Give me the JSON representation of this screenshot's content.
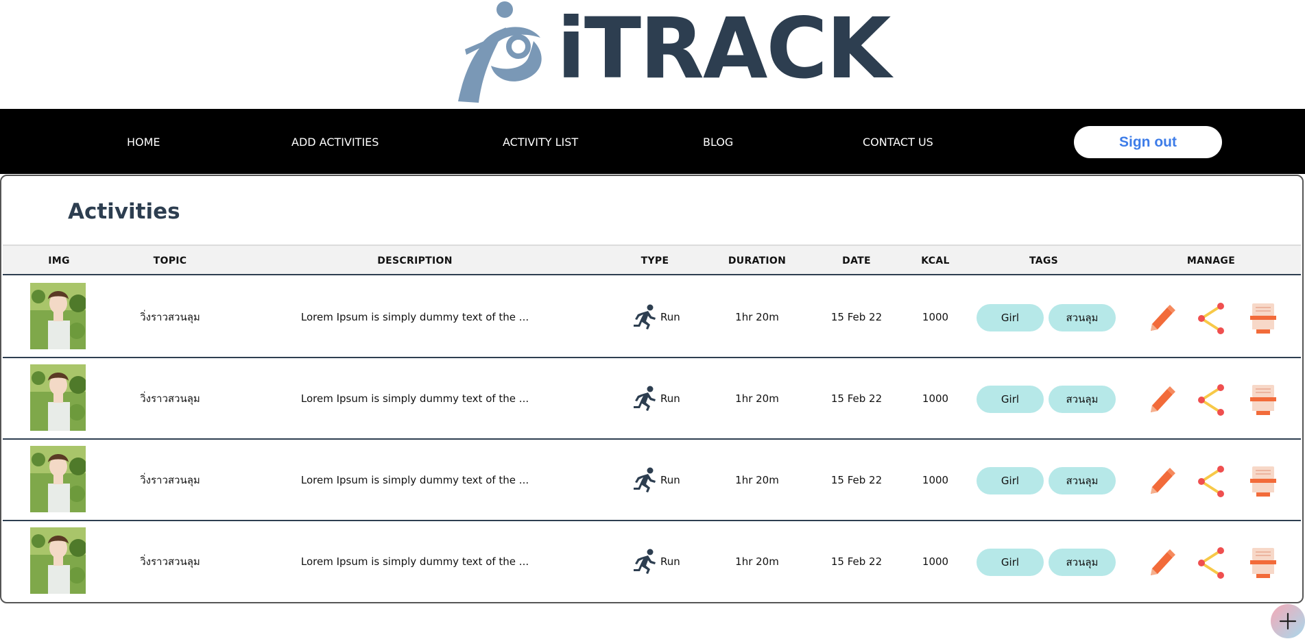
{
  "brand": {
    "name": "iTRACK"
  },
  "nav": {
    "items": [
      {
        "label": "HOME"
      },
      {
        "label": "ADD ACTIVITIES"
      },
      {
        "label": "ACTIVITY LIST"
      },
      {
        "label": "BLOG"
      },
      {
        "label": "CONTACT US"
      }
    ],
    "signout_label": "Sign out"
  },
  "page": {
    "title": "Activities"
  },
  "table": {
    "columns": [
      "IMG",
      "TOPIC",
      "DESCRIPTION",
      "TYPE",
      "DURATION",
      "DATE",
      "KCAL",
      "TAGS",
      "MANAGE"
    ],
    "rows": [
      {
        "topic": "วิ่งราวสวนลุม",
        "description": "Lorem Ipsum is simply dummy text of the ...",
        "type": "Run",
        "duration": "1hr 20m",
        "date": "15 Feb 22",
        "kcal": "1000",
        "tags": [
          "Girl",
          "สวนลุม"
        ]
      },
      {
        "topic": "วิ่งราวสวนลุม",
        "description": "Lorem Ipsum is simply dummy text of the ...",
        "type": "Run",
        "duration": "1hr 20m",
        "date": "15 Feb 22",
        "kcal": "1000",
        "tags": [
          "Girl",
          "สวนลุม"
        ]
      },
      {
        "topic": "วิ่งราวสวนลุม",
        "description": "Lorem Ipsum is simply dummy text of the ...",
        "type": "Run",
        "duration": "1hr 20m",
        "date": "15 Feb 22",
        "kcal": "1000",
        "tags": [
          "Girl",
          "สวนลุม"
        ]
      },
      {
        "topic": "วิ่งราวสวนลุม",
        "description": "Lorem Ipsum is simply dummy text of the ...",
        "type": "Run",
        "duration": "1hr 20m",
        "date": "15 Feb 22",
        "kcal": "1000",
        "tags": [
          "Girl",
          "สวนลุม"
        ]
      }
    ]
  },
  "icons": {
    "type": "running-icon",
    "manage": [
      "edit-pencil-icon",
      "share-icon",
      "delete-trash-icon"
    ],
    "fab": "plus-icon"
  },
  "colors": {
    "brand_dark": "#2d3e50",
    "brand_light": "#7a98b6",
    "navbar": "#000000",
    "signout_text": "#3d7ce8",
    "tag_bg": "#b6e8e8",
    "edit_orange": "#f26b3a",
    "share_yellow": "#f7c948"
  }
}
